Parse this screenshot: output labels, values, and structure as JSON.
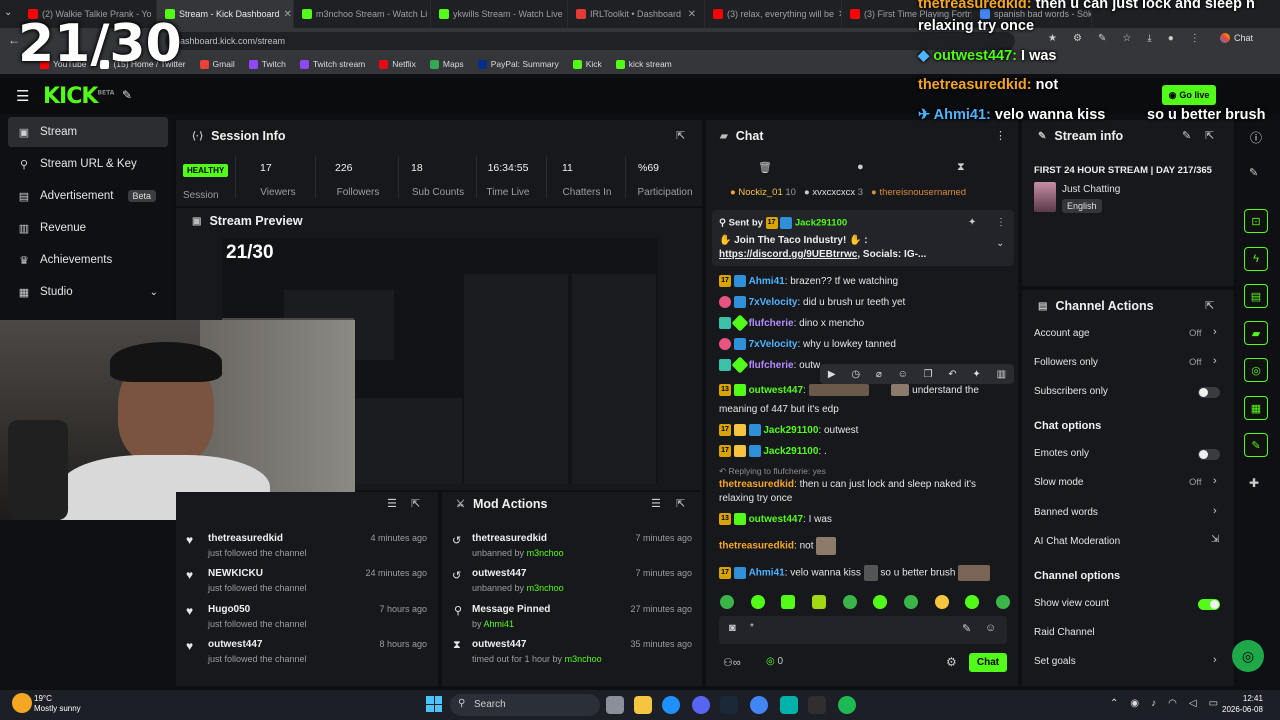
{
  "overlay": {
    "counter": "21/30",
    "lines": [
      {
        "user": "thetreasuredkid:",
        "text": "then u can just lock and sleep n"
      },
      {
        "user": "",
        "text": "relaxing try once"
      },
      {
        "user": "outwest447:",
        "text": "I was"
      },
      {
        "user": "thetreasuredkid:",
        "text": "not"
      },
      {
        "user": "Ahmi41:",
        "text": "velo wanna kiss"
      },
      {
        "user": "",
        "text": "so u better brush"
      }
    ]
  },
  "browser": {
    "tabs": [
      {
        "title": "(2) Walkie Talkie Prank - Yo",
        "color": "#ff0000"
      },
      {
        "title": "Stream - Kick Dashboard",
        "color": "#53fc18"
      },
      {
        "title": "m3nchoo Stream - Watch Li",
        "color": "#53fc18"
      },
      {
        "title": "ykwills Stream - Watch Live",
        "color": "#53fc18"
      },
      {
        "title": "IRLToolkit • Dashboard",
        "color": "#e53935"
      },
      {
        "title": "(3) relax, everything will be",
        "color": "#ff0000"
      },
      {
        "title": "(3) First Time Playing Fortnit",
        "color": "#ff0000"
      },
      {
        "title": "spanish bad words - Sök",
        "color": "#4285f4"
      }
    ],
    "url": "dashboard.kick.com/stream",
    "bookmarks": [
      {
        "label": "YouTube",
        "color": "#ff0000"
      },
      {
        "label": "(15) Home / Twitter",
        "color": "#ffffff"
      },
      {
        "label": "Gmail",
        "color": "#ea4335"
      },
      {
        "label": "Twitch",
        "color": "#9146ff"
      },
      {
        "label": "Twitch stream",
        "color": "#9146ff"
      },
      {
        "label": "Netflix",
        "color": "#e50914"
      },
      {
        "label": "Maps",
        "color": "#34a853"
      },
      {
        "label": "PayPal: Summary",
        "color": "#003087"
      },
      {
        "label": "Kick",
        "color": "#53fc18"
      },
      {
        "label": "kick stream",
        "color": "#53fc18"
      }
    ],
    "chat_btn": "Chat"
  },
  "kick": {
    "logo": "KICK",
    "beta": "BETA",
    "go_live": "Go live"
  },
  "sidebar": {
    "items": [
      {
        "label": "Stream",
        "icon": "stream-icon"
      },
      {
        "label": "Stream URL & Key",
        "icon": "link-icon"
      },
      {
        "label": "Advertisement",
        "icon": "ad-icon"
      },
      {
        "label": "Revenue",
        "icon": "revenue-icon"
      },
      {
        "label": "Achievements",
        "icon": "trophy-icon"
      },
      {
        "label": "Studio",
        "icon": "studio-icon"
      }
    ],
    "beta": "Beta"
  },
  "session": {
    "title": "Session Info",
    "status": "HEALTHY",
    "status_label": "Session",
    "stats": [
      {
        "value": "17",
        "label": "Viewers"
      },
      {
        "value": "226",
        "label": "Followers"
      },
      {
        "value": "18",
        "label": "Sub Counts"
      },
      {
        "value": "16:34:55",
        "label": "Time Live"
      },
      {
        "value": "11",
        "label": "Chatters In"
      },
      {
        "value": "%69",
        "label": "Participation"
      }
    ]
  },
  "preview": {
    "title": "Stream Preview"
  },
  "activity": [
    {
      "name": "thetreasuredkid",
      "sub": "just followed the channel",
      "time": "4 minutes ago"
    },
    {
      "name": "NEWKICKU",
      "sub": "just followed the channel",
      "time": "24 minutes ago"
    },
    {
      "name": "Hugo050",
      "sub": "just followed the channel",
      "time": "7 hours ago"
    },
    {
      "name": "outwest447",
      "sub": "just followed the channel",
      "time": "8 hours ago"
    }
  ],
  "mod": {
    "title": "Mod Actions",
    "items": [
      {
        "name": "thetreasuredkid",
        "sub": "unbanned by",
        "by": "m3nchoo",
        "time": "7 minutes ago",
        "icon": "undo-icon"
      },
      {
        "name": "outwest447",
        "sub": "unbanned by",
        "by": "m3nchoo",
        "time": "7 minutes ago",
        "icon": "undo-icon"
      },
      {
        "name": "Message Pinned",
        "sub": "by",
        "by": "Ahmi41",
        "time": "27 minutes ago",
        "icon": "pin-icon"
      },
      {
        "name": "outwest447",
        "sub": "timed out for 1 hour by",
        "by": "m3nchoo",
        "time": "35 minutes ago",
        "icon": "hourglass-icon"
      }
    ]
  },
  "chat": {
    "title": "Chat",
    "top_gifters": [
      {
        "name": "Nockiz_01",
        "count": "10"
      },
      {
        "name": "xvxcxcxcx",
        "count": "3"
      },
      {
        "name": "thereisnousernamed",
        "count": ""
      }
    ],
    "pinned": {
      "sent_by": "Sent by",
      "user": "Jack291100",
      "text": "Join The Taco Industry!",
      "link": "https://discord.gg/9UEBtrrwc",
      "link_suffix": ", Socials: IG-..."
    },
    "messages": [
      {
        "user": "Ahmi41",
        "text": "brazen?? tf we watching",
        "ucolor": "blue"
      },
      {
        "user": "7xVelocity",
        "text": "did u brush ur teeth yet",
        "ucolor": "blue"
      },
      {
        "user": "flufcherie",
        "text": "dino x mencho",
        "ucolor": "purple"
      },
      {
        "user": "7xVelocity",
        "text": "why u lowkey tanned",
        "ucolor": "blue"
      },
      {
        "user": "flufcherie",
        "text": "outw",
        "ucolor": "purple"
      },
      {
        "user": "outwest447",
        "text": "understand the",
        "ucolor": "green"
      },
      {
        "user": "",
        "text": "meaning of 447 but it's edp",
        "ucolor": ""
      },
      {
        "user": "Jack291100",
        "text": "outwest",
        "ucolor": "blue"
      },
      {
        "user": "Jack291100",
        "text": ".",
        "ucolor": "blue"
      }
    ],
    "reply_to": "Replying to flufcherie: yes",
    "reply_user": "thetreasuredkid",
    "reply_text": "then u can just lock and sleep naked it's",
    "reply_text2": "relaxing try once",
    "m_outwest_user": "outwest447",
    "m_outwest_text": "I was",
    "m_treasured_user": "thetreasuredkid",
    "m_treasured_text": "not",
    "m_ahmi_user": "Ahmi41",
    "m_ahmi_text": "velo wanna kiss",
    "m_ahmi_text2": "so u better brush",
    "input_placeholder": "*",
    "count": "0",
    "send": "Chat"
  },
  "stream_info": {
    "title": "Stream info",
    "stream_title": "FIRST 24 HOUR STREAM | DAY 217/365",
    "category": "Just Chatting",
    "language": "English"
  },
  "channel_actions": {
    "title": "Channel Actions",
    "rows": [
      {
        "label": "Account age",
        "value": "Off"
      },
      {
        "label": "Followers only",
        "value": "Off"
      },
      {
        "label": "Subscribers only",
        "value": ""
      }
    ],
    "chat_options": "Chat options",
    "chat_rows": [
      {
        "label": "Emotes only",
        "value": ""
      },
      {
        "label": "Slow mode",
        "value": "Off"
      },
      {
        "label": "Banned words",
        "value": ""
      },
      {
        "label": "AI Chat Moderation",
        "value": ""
      }
    ],
    "channel_options": "Channel options",
    "channel_rows": [
      {
        "label": "Show view count",
        "value": ""
      },
      {
        "label": "Raid Channel",
        "value": ""
      },
      {
        "label": "Set goals",
        "value": ""
      }
    ]
  },
  "taskbar": {
    "weather_temp": "19°C",
    "weather_text": "Mostly sunny",
    "search": "Search",
    "time": "12:41",
    "date": "2026-06-08"
  }
}
